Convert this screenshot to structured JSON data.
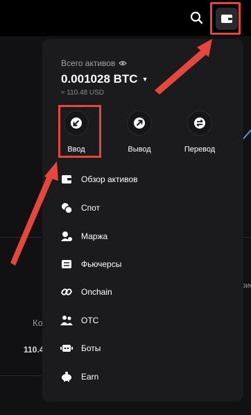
{
  "panel": {
    "total_assets_label": "Всего активов",
    "balance": "0.001028 BTC",
    "balance_usd": "≈ 110.48 USD",
    "actions": [
      {
        "label": "Ввод"
      },
      {
        "label": "Вывод"
      },
      {
        "label": "Перевод"
      }
    ],
    "menu": [
      {
        "label": "Обзор активов",
        "icon": "wallet-icon"
      },
      {
        "label": "Спот",
        "icon": "coins-icon"
      },
      {
        "label": "Маржа",
        "icon": "margin-icon"
      },
      {
        "label": "Фьючерсы",
        "icon": "futures-icon"
      },
      {
        "label": "Onchain",
        "icon": "link-icon"
      },
      {
        "label": "OTC",
        "icon": "users-icon"
      },
      {
        "label": "Боты",
        "icon": "bot-icon"
      },
      {
        "label": "Earn",
        "icon": "piggy-bank-icon"
      }
    ]
  },
  "background": {
    "left_text": "Ко",
    "left_number": "110.4",
    "right_text": "рис"
  },
  "colors": {
    "highlight": "#e5473d",
    "panel": "#1b1b1d"
  }
}
